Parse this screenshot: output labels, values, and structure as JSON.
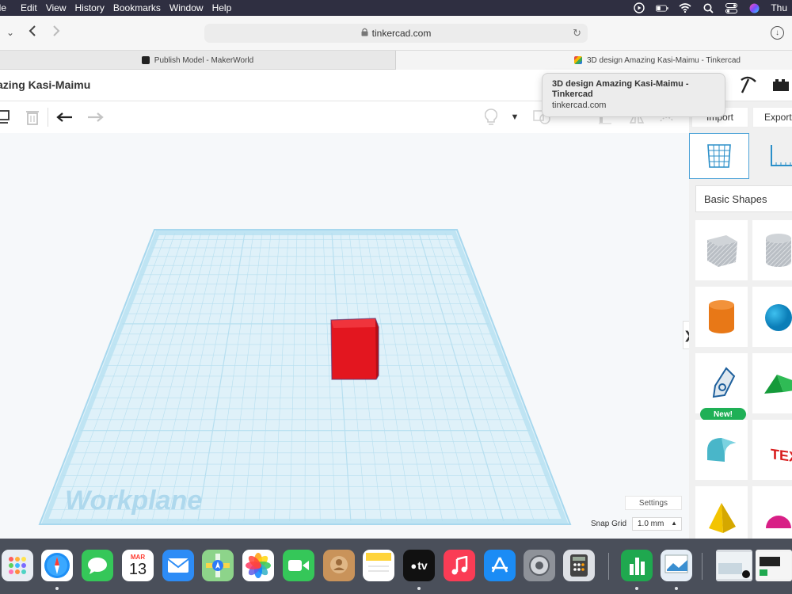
{
  "menubar": {
    "items": [
      "ile",
      "Edit",
      "View",
      "History",
      "Bookmarks",
      "Window",
      "Help"
    ],
    "clock": "Thu"
  },
  "browser": {
    "url": "tinkercad.com",
    "tabs": [
      {
        "title": "Publish Model - MakerWorld"
      },
      {
        "title": "3D design Amazing Kasi-Maimu - Tinkercad"
      }
    ]
  },
  "tooltip": {
    "title": "3D design Amazing Kasi-Maimu - Tinkercad",
    "url": "tinkercad.com"
  },
  "header": {
    "design_title": "azing Kasi-Maimu"
  },
  "panel": {
    "import_label": "Import",
    "export_label": "Export",
    "category": "Basic Shapes",
    "new_badge": "New!"
  },
  "canvas": {
    "workplane_label": "Workplane",
    "settings_label": "Settings",
    "snap_grid_label": "Snap Grid",
    "snap_grid_value": "1.0 mm",
    "colors": {
      "box": "#e3161f",
      "grid_line": "#b7dff0",
      "plane": "#dff1f9"
    }
  },
  "dock": {
    "calendar_month": "MAR",
    "calendar_day": "13",
    "tv_label": "tv"
  }
}
